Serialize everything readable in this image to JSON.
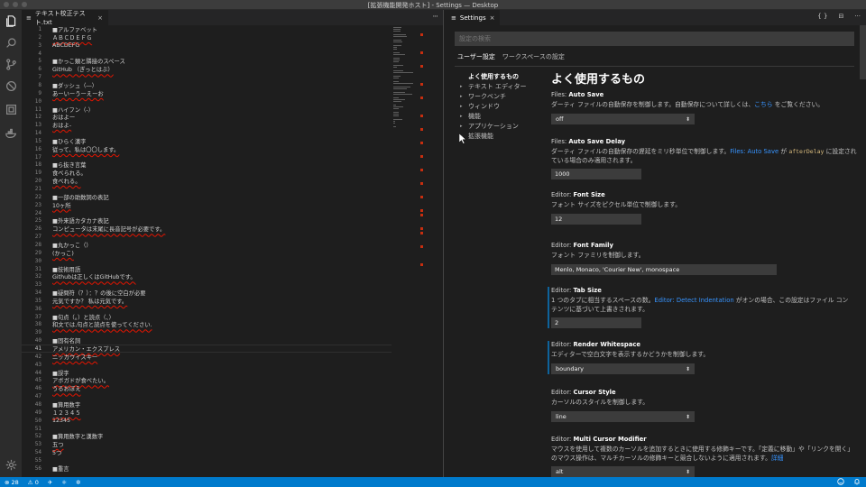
{
  "window": {
    "title": "[拡張機能開発ホスト] - Settings — Desktop"
  },
  "activity_bar": {
    "icons": [
      "files-icon",
      "search-icon",
      "source-control-icon",
      "debug-icon",
      "extensions-icon",
      "docker-icon",
      "settings-gear-icon"
    ]
  },
  "editor": {
    "tab": {
      "icon": "≡",
      "label": "テキスト校正テスト.txt",
      "close": "×"
    },
    "more": "···",
    "current_line": 41,
    "lines": [
      {
        "n": 1,
        "text": "■アルファベット",
        "err": false
      },
      {
        "n": 2,
        "text": "ＡＢＣＤＥＦＧ",
        "err": true
      },
      {
        "n": 3,
        "text": "ABCDEFG",
        "err": false
      },
      {
        "n": 4,
        "text": "",
        "err": false
      },
      {
        "n": 5,
        "text": "■かっこ類と隣接のスペース",
        "err": false
      },
      {
        "n": 6,
        "text": "GitHub （ぎっとはぶ）",
        "err": true
      },
      {
        "n": 7,
        "text": "",
        "err": false
      },
      {
        "n": 8,
        "text": "■ダッシュ（―）",
        "err": false
      },
      {
        "n": 9,
        "text": "あーいーうーえーお",
        "err": true
      },
      {
        "n": 10,
        "text": "",
        "err": false
      },
      {
        "n": 11,
        "text": "■ハイフン（-）",
        "err": false
      },
      {
        "n": 12,
        "text": "おはよー",
        "err": false
      },
      {
        "n": 13,
        "text": "おはよ-",
        "err": true
      },
      {
        "n": 14,
        "text": "",
        "err": false
      },
      {
        "n": 15,
        "text": "■ひらく漢字",
        "err": false
      },
      {
        "n": 16,
        "text": "従って、私は〇〇します。",
        "err": true
      },
      {
        "n": 17,
        "text": "",
        "err": false
      },
      {
        "n": 18,
        "text": "■ら抜き言葉",
        "err": false
      },
      {
        "n": 19,
        "text": "食べられる。",
        "err": false
      },
      {
        "n": 20,
        "text": "食べれる。",
        "err": true
      },
      {
        "n": 21,
        "text": "",
        "err": false
      },
      {
        "n": 22,
        "text": "■一部の助数詞の表記",
        "err": false
      },
      {
        "n": 23,
        "text": "10ヶ所",
        "err": true
      },
      {
        "n": 24,
        "text": "",
        "err": false
      },
      {
        "n": 25,
        "text": "■外来語カタカナ表記",
        "err": false
      },
      {
        "n": 26,
        "text": "コンピュータは末尾に長音記号が必要です。",
        "err": true
      },
      {
        "n": 27,
        "text": "",
        "err": false
      },
      {
        "n": 28,
        "text": "■丸かっこ（）",
        "err": false
      },
      {
        "n": 29,
        "text": "(かっこ)",
        "err": true
      },
      {
        "n": 30,
        "text": "",
        "err": false
      },
      {
        "n": 31,
        "text": "■技術用語",
        "err": false
      },
      {
        "n": 32,
        "text": "Githubは正しくはGitHubです。",
        "err": true
      },
      {
        "n": 33,
        "text": "",
        "err": false
      },
      {
        "n": 34,
        "text": "■疑問符（？）：？の後に空白が必要",
        "err": false
      },
      {
        "n": 35,
        "text": "元気ですか？ 私は元気です。",
        "err": true
      },
      {
        "n": 36,
        "text": "",
        "err": false
      },
      {
        "n": 37,
        "text": "■句点（。）と読点（、）",
        "err": false
      },
      {
        "n": 38,
        "text": "和文では,句点と読点を使ってください.",
        "err": true
      },
      {
        "n": 39,
        "text": "",
        "err": false
      },
      {
        "n": 40,
        "text": "■固有名詞",
        "err": false
      },
      {
        "n": 41,
        "text": "アメリカン・エクスプレス",
        "err": true
      },
      {
        "n": 42,
        "text": "ニッカウイスキー",
        "err": true
      },
      {
        "n": 43,
        "text": "",
        "err": false
      },
      {
        "n": 44,
        "text": "■誤字",
        "err": false
      },
      {
        "n": 45,
        "text": "アボガドが食べたい。",
        "err": true
      },
      {
        "n": 46,
        "text": "うるおぼえ",
        "err": true
      },
      {
        "n": 47,
        "text": "",
        "err": false
      },
      {
        "n": 48,
        "text": "■算用数字",
        "err": false
      },
      {
        "n": 49,
        "text": "１２３４５",
        "err": true
      },
      {
        "n": 50,
        "text": "12345",
        "err": false
      },
      {
        "n": 51,
        "text": "",
        "err": false
      },
      {
        "n": 52,
        "text": "■算用数字と漢数字",
        "err": false
      },
      {
        "n": 53,
        "text": "五つ",
        "err": true
      },
      {
        "n": 54,
        "text": "5つ",
        "err": false
      },
      {
        "n": 55,
        "text": "",
        "err": false
      },
      {
        "n": 56,
        "text": "■重言",
        "err": false
      }
    ]
  },
  "settings_tab": {
    "icon": "≡",
    "label": "Settings",
    "close": "×",
    "actions": [
      "{ }",
      "⊟",
      "···"
    ]
  },
  "settings": {
    "search_placeholder": "設定の検索",
    "scope_tabs": [
      "ユーザー設定",
      "ワークスペースの設定"
    ],
    "toc": [
      {
        "label": "よく使用するもの",
        "arrow": "",
        "active": true
      },
      {
        "label": "テキスト エディター",
        "arrow": "▸",
        "active": false
      },
      {
        "label": "ワークベンチ",
        "arrow": "▸",
        "active": false
      },
      {
        "label": "ウィンドウ",
        "arrow": "▸",
        "active": false
      },
      {
        "label": "機能",
        "arrow": "▸",
        "active": false
      },
      {
        "label": "アプリケーション",
        "arrow": "▸",
        "active": false
      },
      {
        "label": "拡張機能",
        "arrow": "▸",
        "active": false
      }
    ],
    "section_title": "よく使用するもの",
    "items": [
      {
        "category": "Files: ",
        "name": "Auto Save",
        "desc_pre": "ダーティ ファイルの自動保存を制御します。自動保存について詳しくは、",
        "desc_link": "こちら",
        "desc_post": " をご覧ください。",
        "control": "select",
        "value": "off",
        "modified": false
      },
      {
        "category": "Files: ",
        "name": "Auto Save Delay",
        "desc_pre": "ダーティ ファイルの自動保存の遅延をミリ秒単位で制御します。",
        "desc_link": "Files: Auto Save",
        "desc_mid": " が ",
        "desc_code": "afterDelay",
        "desc_post": " に設定されている場合のみ適用されます。",
        "control": "input",
        "value": "1000",
        "modified": false
      },
      {
        "category": "Editor: ",
        "name": "Font Size",
        "desc_pre": "フォント サイズをピクセル単位で制御します。",
        "control": "input",
        "value": "12",
        "modified": false
      },
      {
        "category": "Editor: ",
        "name": "Font Family",
        "desc_pre": "フォント ファミリを制御します。",
        "control": "input-wide",
        "value": "Menlo, Monaco, 'Courier New', monospace",
        "modified": false
      },
      {
        "category": "Editor: ",
        "name": "Tab Size",
        "desc_pre": "1 つのタブに相当するスペースの数。",
        "desc_link": "Editor: Detect Indentation",
        "desc_post": " がオンの場合、この設定はファイル コンテンツに基づいて上書きされます。",
        "control": "input",
        "value": "2",
        "modified": true
      },
      {
        "category": "Editor: ",
        "name": "Render Whitespace",
        "desc_pre": "エディターで空白文字を表示するかどうかを制御します。",
        "control": "select",
        "value": "boundary",
        "modified": true
      },
      {
        "category": "Editor: ",
        "name": "Cursor Style",
        "desc_pre": "カーソルのスタイルを制御します。",
        "control": "select",
        "value": "line",
        "modified": false
      },
      {
        "category": "Editor: ",
        "name": "Multi Cursor Modifier",
        "desc_pre": "マウスを使用して複数のカーソルを追加するときに使用する修飾キーです。「定義に移動」や「リンクを開く」のマウス操作は、マルチカーソルの修飾キーと競合しないように適用されます。",
        "desc_link": "詳細",
        "control": "select",
        "value": "alt",
        "modified": false
      }
    ]
  },
  "statusbar": {
    "errors": "⊗ 28",
    "warnings": "⚠ 0",
    "items": [
      "✈",
      "⚛",
      "✲"
    ],
    "right_icons": [
      "smiley-icon",
      "bell-icon"
    ]
  },
  "colors": {
    "accent": "#007acc",
    "error_squiggle": "#e51400",
    "link": "#3794ff"
  }
}
